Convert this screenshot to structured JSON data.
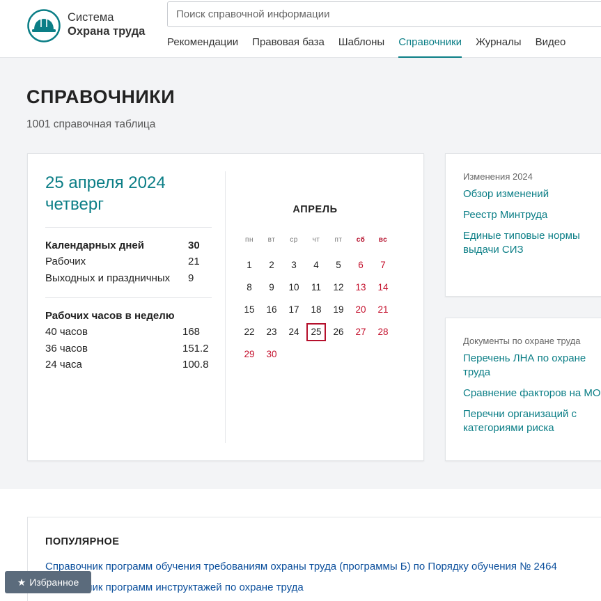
{
  "brand": {
    "line1": "Система",
    "line2": "Охрана труда"
  },
  "search": {
    "placeholder": "Поиск справочной информации"
  },
  "nav": {
    "items": [
      "Рекомендации",
      "Правовая база",
      "Шаблоны",
      "Справочники",
      "Журналы",
      "Видео"
    ],
    "active": "Справочники"
  },
  "page": {
    "title": "СПРАВОЧНИКИ",
    "subtitle": "1001 справочная таблица"
  },
  "today": {
    "date": "25 апреля 2024",
    "weekday": "четверг"
  },
  "stats": {
    "calendar_days_label": "Календарных дней",
    "calendar_days": "30",
    "working_label": "Рабочих",
    "working": "21",
    "weekend_label": "Выходных и праздничных",
    "weekend": "9"
  },
  "hours": {
    "title": "Рабочих часов в неделю",
    "rows": [
      {
        "label": "40 часов",
        "value": "168"
      },
      {
        "label": "36 часов",
        "value": "151.2"
      },
      {
        "label": "24 часа",
        "value": "100.8"
      }
    ]
  },
  "calendar": {
    "month": "АПРЕЛЬ",
    "weekdays": [
      "пн",
      "вт",
      "ср",
      "чт",
      "пт",
      "сб",
      "вс"
    ],
    "weeks": [
      [
        "1",
        "2",
        "3",
        "4",
        "5",
        "6",
        "7"
      ],
      [
        "8",
        "9",
        "10",
        "11",
        "12",
        "13",
        "14"
      ],
      [
        "15",
        "16",
        "17",
        "18",
        "19",
        "20",
        "21"
      ],
      [
        "22",
        "23",
        "24",
        "25",
        "26",
        "27",
        "28"
      ],
      [
        "29",
        "30",
        "",
        "",
        "",
        "",
        ""
      ]
    ],
    "today": "25"
  },
  "changes": {
    "heading": "Изменения 2024",
    "links": [
      "Обзор изменений",
      "Реестр Минтруда",
      "Единые типовые нормы выдачи СИЗ"
    ]
  },
  "docs": {
    "heading": "Документы по охране труда",
    "links": [
      "Перечень ЛНА по охране труда",
      "Сравнение факторов на МО",
      "Перечни организаций с категориями риска"
    ]
  },
  "popular": {
    "title": "ПОПУЛЯРНОЕ",
    "links": [
      "Справочник программ обучения требованиям охраны труда (программы Б) по Порядку обучения № 2464",
      "Справочник программ инструктажей по охране труда"
    ]
  },
  "favorites": {
    "label": "Избранное"
  },
  "colors": {
    "accent": "#0b7e86",
    "weekend": "#c4102c",
    "link": "#0b4f9c"
  }
}
